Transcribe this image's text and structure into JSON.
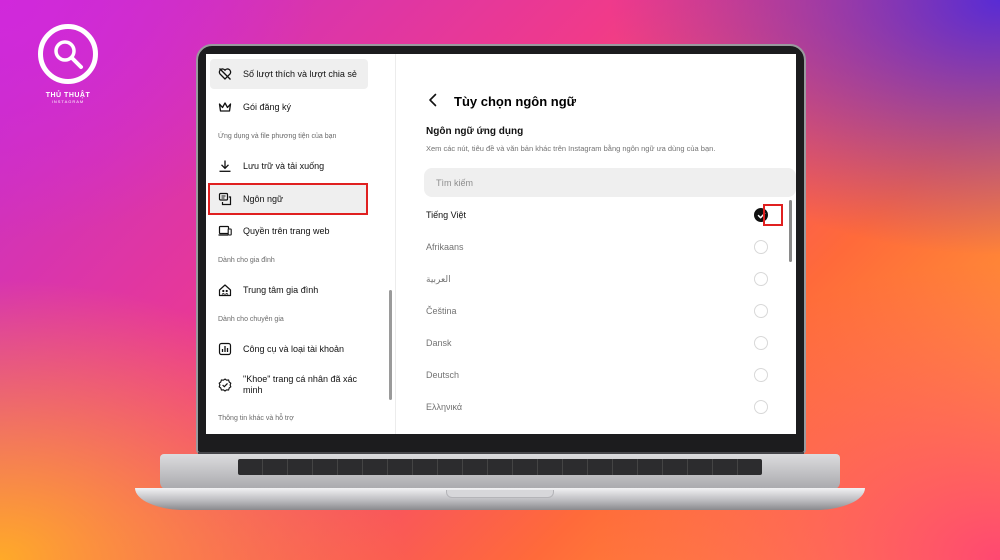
{
  "watermark": {
    "title": "THỦ THUẬT",
    "subtitle": "INSTAGRAM"
  },
  "sidebar": {
    "items": [
      {
        "id": "likes",
        "label": "Số lượt thích và lượt chia sẻ",
        "icon": "heart-off-icon"
      },
      {
        "id": "subscriptions",
        "label": "Gói đăng ký",
        "icon": "crown-icon"
      },
      {
        "id": "archive",
        "label": "Lưu trữ và tải xuống",
        "icon": "download-icon"
      },
      {
        "id": "language",
        "label": "Ngôn ngữ",
        "icon": "language-chat-icon"
      },
      {
        "id": "web-permissions",
        "label": "Quyền trên trang web",
        "icon": "devices-icon"
      },
      {
        "id": "family-center",
        "label": "Trung tâm gia đình",
        "icon": "family-home-icon"
      },
      {
        "id": "account-tools",
        "label": "Công cụ và loại tài khoản",
        "icon": "bar-chart-icon"
      },
      {
        "id": "verified",
        "label": "\"Khoe\" trang cá nhân đã xác minh",
        "icon": "verified-badge-icon"
      }
    ],
    "sections": [
      "Ứng dụng và file phương tiện của bạn",
      "Dành cho gia đình",
      "Dành cho chuyên gia",
      "Thông tin khác và hỗ trợ"
    ]
  },
  "panel": {
    "title": "Tùy chọn ngôn ngữ",
    "section_title": "Ngôn ngữ ứng dụng",
    "section_desc": "Xem các nút, tiêu đề và văn bản khác trên Instagram bằng ngôn ngữ ưa dùng của bạn.",
    "search_placeholder": "Tìm kiếm",
    "selected_language": "Tiếng Việt",
    "languages": [
      "Tiếng Việt",
      "Afrikaans",
      "العربية",
      "Čeština",
      "Dansk",
      "Deutsch",
      "Ελληνικά"
    ]
  },
  "colors": {
    "highlight": "#e02020",
    "check": "#111111"
  }
}
